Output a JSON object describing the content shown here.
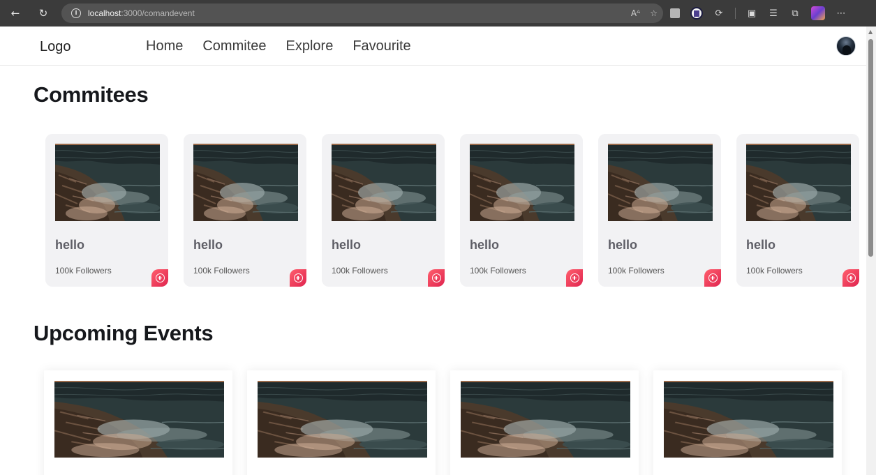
{
  "browser": {
    "url_host": "localhost",
    "url_path": ":3000/comandevent",
    "read_aloud_label": "Aᴬ"
  },
  "nav": {
    "logo": "Logo",
    "links": [
      "Home",
      "Commitee",
      "Explore",
      "Favourite"
    ]
  },
  "sections": {
    "committees_title": "Commitees",
    "events_title": "Upcoming Events"
  },
  "committees": [
    {
      "name": "hello",
      "followers": "100k Followers"
    },
    {
      "name": "hello",
      "followers": "100k Followers"
    },
    {
      "name": "hello",
      "followers": "100k Followers"
    },
    {
      "name": "hello",
      "followers": "100k Followers"
    },
    {
      "name": "hello",
      "followers": "100k Followers"
    },
    {
      "name": "hello",
      "followers": "100k Followers"
    }
  ],
  "events": [
    {
      "image": "coastal-waves-photo"
    },
    {
      "image": "coastal-waves-photo"
    },
    {
      "image": "coastal-waves-photo"
    },
    {
      "image": "coastal-waves-photo"
    }
  ],
  "colors": {
    "follow_button_start": "#ff5f6d",
    "follow_button_end": "#e0244f",
    "card_background": "#f2f2f4"
  }
}
